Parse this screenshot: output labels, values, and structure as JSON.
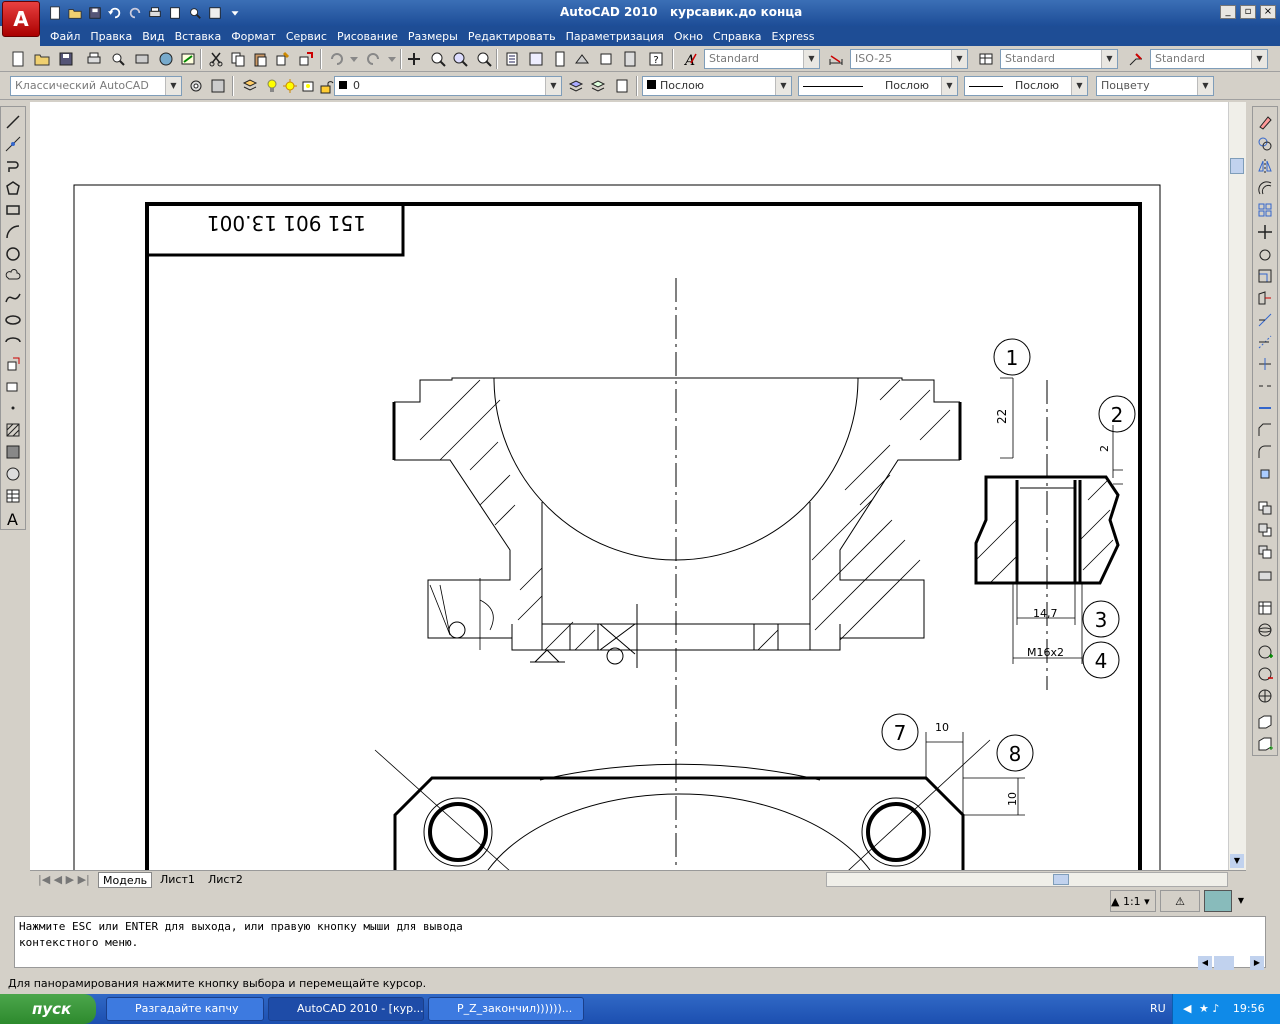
{
  "title": {
    "app": "AutoCAD 2010",
    "doc": "курсавик.до конца",
    "logo": "A"
  },
  "menu": [
    "Файл",
    "Правка",
    "Вид",
    "Вставка",
    "Формат",
    "Сервис",
    "Рисование",
    "Размеры",
    "Редактировать",
    "Параметризация",
    "Окно",
    "Справка",
    "Express"
  ],
  "styles": {
    "text": "Standard",
    "dim": "ISO-25",
    "table": "Standard",
    "mleader": "Standard"
  },
  "workspace": "Классический AutoCAD",
  "layer": "0",
  "props": {
    "color": "Послою",
    "linetype": "Послою",
    "lineweight": "Послою",
    "plotstyle": "Поцвету"
  },
  "drawing": {
    "stamp": "151 901 13.001",
    "dims": {
      "d22": "22",
      "d2": "2",
      "d147": "14,7",
      "dm16": "М16х2",
      "d10a": "10",
      "d10b": "10"
    },
    "balloons": [
      "1",
      "2",
      "3",
      "4",
      "7",
      "8"
    ]
  },
  "tabs": [
    "Модель",
    "Лист1",
    "Лист2"
  ],
  "scale": "1:1",
  "command": {
    "line1": "Нажмите ESC или ENTER для выхода, или правую кнопку мыши для вывода",
    "line2": "контекстного меню."
  },
  "status": "Для панорамирования нажмите кнопку выбора и перемещайте курсор.",
  "taskbar": {
    "start": "пуск",
    "items": [
      "Разгадайте капчу",
      "AutoCAD 2010 - [кур...",
      "P_Z_закончил))))))..."
    ],
    "lang": "RU",
    "time": "19:56"
  }
}
